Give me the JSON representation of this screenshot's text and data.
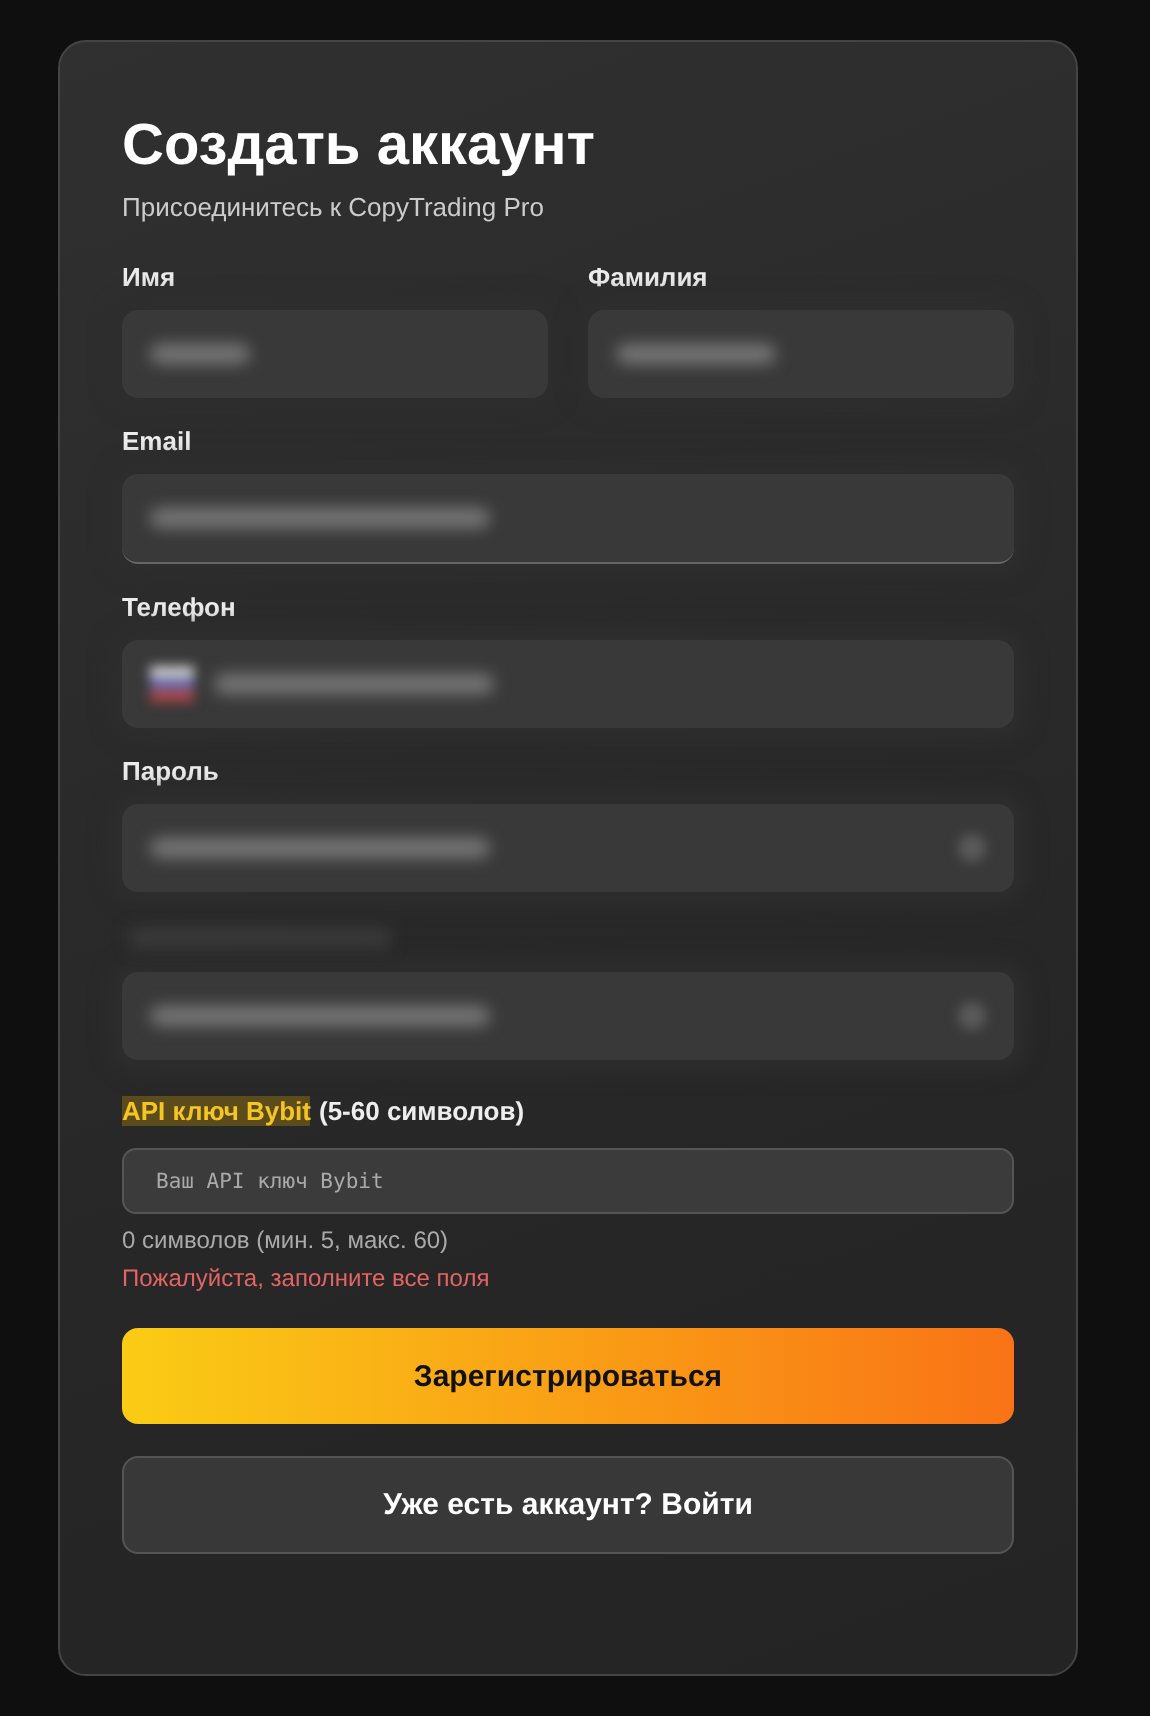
{
  "title": "Создать аккаунт",
  "subtitle": "Присоединитесь к CopyTrading Pro",
  "name_row": [
    {
      "label": "Имя"
    },
    {
      "label": "Фамилия"
    }
  ],
  "fields": [
    {
      "label": "Email",
      "kind": "text"
    },
    {
      "label": "Телефон",
      "kind": "phone"
    },
    {
      "label": "Пароль",
      "kind": "password"
    },
    {
      "kind": "password"
    }
  ],
  "api_key": {
    "label_highlight": "API ключ Bybit",
    "label_rest": "(5-60 символов)",
    "placeholder": "Ваш API ключ Bybit",
    "counter": "0 символов (мин. 5, макс. 60)"
  },
  "error": "Пожалуйста, заполните все поля",
  "buttons": [
    {
      "label": "Зарегистрироваться",
      "kind": "primary"
    },
    {
      "label": "Уже есть аккаунт? Войти",
      "kind": "secondary"
    }
  ]
}
